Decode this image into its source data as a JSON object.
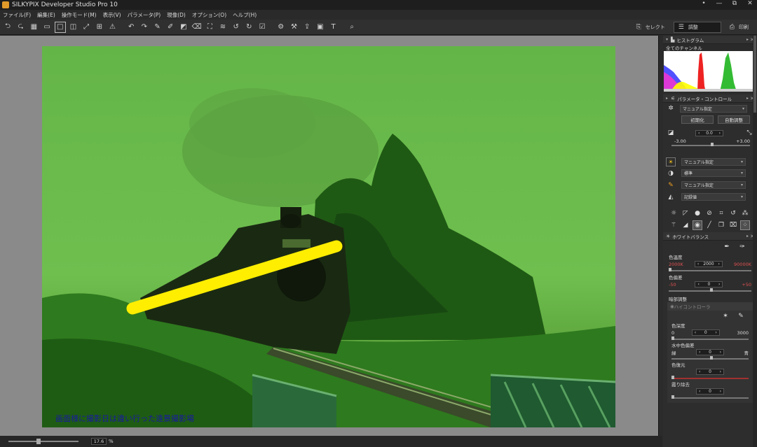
{
  "window": {
    "title": "SILKYPIX Developer Studio Pro 10",
    "controls": [
      "•",
      "—",
      "⧉",
      "✕"
    ]
  },
  "menu": [
    "ファイル(F)",
    "編集(E)",
    "操作モード(M)",
    "表示(V)",
    "パラメータ(P)",
    "現像(D)",
    "オプション(O)",
    "ヘルプ(H)"
  ],
  "toolbar": {
    "select_label": "セレクト",
    "adjust_label": "調整",
    "print_label": "印刷"
  },
  "viewer": {
    "caption": "画面様に撮影日は違い行った遠景撮影場",
    "zoom_value": "17.6",
    "zoom_unit": "%"
  },
  "panel": {
    "histogram": {
      "title": "ヒストグラム",
      "channel": "全てのチャンネル"
    },
    "params": {
      "title": "パラメータ・コントロール",
      "preset": "マニュアル指定",
      "init_button": "初期化",
      "auto_button": "自動調整",
      "exposure_value": "0.0",
      "exposure_min": "-3.00",
      "exposure_max": "+3.00",
      "wb_preset": "マニュアル指定",
      "tone_preset": "標準",
      "color_preset": "マニュアル指定",
      "sharp_preset": "記録値"
    },
    "white_balance": {
      "title": "ホワイトバランス",
      "temp_label": "色温度",
      "temp_min": "2000K",
      "temp_value": "2000",
      "temp_max": "90000K",
      "tint_label": "色偏差",
      "tint_min": "-50",
      "tint_value": "0",
      "tint_max": "+50"
    },
    "shadow": {
      "title": "暗部調整",
      "sub_title": "ハイコントローラ",
      "depth_label": "色深度",
      "depth_min": "0",
      "depth_value": "0",
      "depth_max": "3000",
      "underwater_label": "水中色偏差",
      "underwater_left": "緑",
      "underwater_value": "0",
      "underwater_right": "青",
      "restore_label": "色復元",
      "restore_value": "0",
      "haze_label": "霞り除去",
      "haze_value": "0"
    }
  }
}
